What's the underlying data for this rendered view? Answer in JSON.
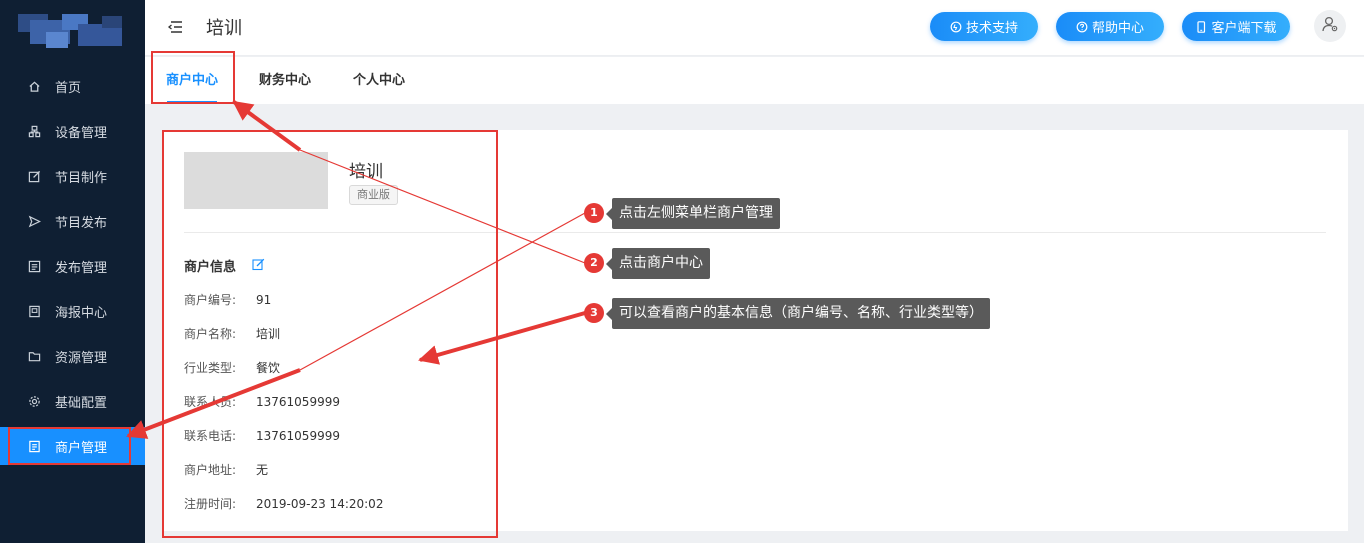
{
  "sidebar": {
    "items": [
      {
        "label": "首页",
        "icon": "home-icon"
      },
      {
        "label": "设备管理",
        "icon": "device-icon"
      },
      {
        "label": "节目制作",
        "icon": "edit-icon"
      },
      {
        "label": "节目发布",
        "icon": "send-icon"
      },
      {
        "label": "发布管理",
        "icon": "list-icon"
      },
      {
        "label": "海报中心",
        "icon": "poster-icon"
      },
      {
        "label": "资源管理",
        "icon": "folder-icon"
      },
      {
        "label": "基础配置",
        "icon": "gear-icon"
      },
      {
        "label": "商户管理",
        "icon": "merchant-icon",
        "active": true
      }
    ]
  },
  "header": {
    "title": "培训",
    "buttons": {
      "support": "技术支持",
      "help": "帮助中心",
      "download": "客户端下载"
    }
  },
  "tabs": [
    {
      "label": "商户中心",
      "active": true
    },
    {
      "label": "财务中心"
    },
    {
      "label": "个人中心"
    }
  ],
  "merchant": {
    "name": "培训",
    "edition": "商业版",
    "section_title": "商户信息",
    "fields": [
      {
        "label": "商户编号:",
        "value": "91"
      },
      {
        "label": "商户名称:",
        "value": "培训"
      },
      {
        "label": "行业类型:",
        "value": "餐饮"
      },
      {
        "label": "联系人员:",
        "value": "13761059999"
      },
      {
        "label": "联系电话:",
        "value": "13761059999"
      },
      {
        "label": "商户地址:",
        "value": "无"
      },
      {
        "label": "注册时间:",
        "value": "2019-09-23 14:20:02"
      }
    ]
  },
  "annotations": [
    {
      "number": "1",
      "text": "点击左侧菜单栏商户管理"
    },
    {
      "number": "2",
      "text": "点击商户中心"
    },
    {
      "number": "3",
      "text": "可以查看商户的基本信息（商户编号、名称、行业类型等）"
    }
  ],
  "colors": {
    "sidebar_bg": "#0f1f33",
    "accent": "#1890ff",
    "annotation_red": "#e53935",
    "callout_bg": "#5a5a5a"
  }
}
